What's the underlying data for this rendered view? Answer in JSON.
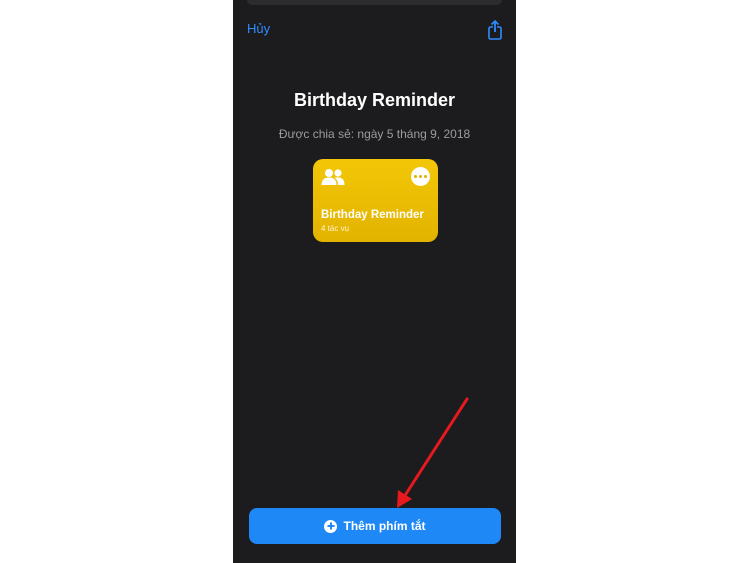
{
  "nav": {
    "cancel_label": "Hủy",
    "share_icon": "share-icon"
  },
  "shortcut": {
    "title": "Birthday Reminder",
    "shared_date": "Được chia sẻ: ngày 5 tháng 9, 2018",
    "card_name": "Birthday Reminder",
    "card_action_count": "4 tác vụ",
    "card_color": "#f0c000",
    "card_icon": "people-icon"
  },
  "footer": {
    "add_button_label": "Thêm phím tắt",
    "add_button_color": "#1e88f7"
  },
  "annotation": {
    "arrow_color": "#e8191e"
  }
}
